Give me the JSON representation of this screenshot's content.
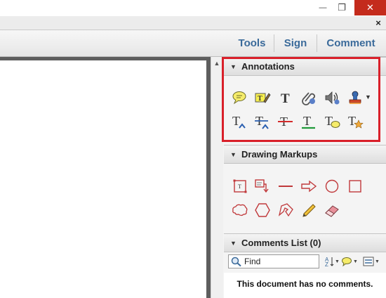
{
  "window": {
    "minimize_glyph": "—",
    "maximize_glyph": "❐",
    "close_glyph": "✕",
    "panel_close_glyph": "×"
  },
  "toolbar": {
    "tools_label": "Tools",
    "sign_label": "Sign",
    "comment_label": "Comment"
  },
  "pane": {
    "annotations": {
      "title": "Annotations",
      "tools": [
        "sticky-note",
        "highlight-text",
        "add-text",
        "attach-file",
        "record-audio",
        "stamp",
        "insert-text",
        "replace-text",
        "strikethrough",
        "underline",
        "add-note-to-text",
        "text-correction-markup"
      ]
    },
    "drawing_markups": {
      "title": "Drawing Markups",
      "tools": [
        "text-box",
        "callout",
        "line",
        "arrow",
        "oval",
        "rectangle",
        "cloud",
        "polygon",
        "connected-lines",
        "pencil",
        "pencil-eraser"
      ]
    },
    "comments_list": {
      "title": "Comments List (0)",
      "find_placeholder": "Find",
      "empty_message": "This document has no comments."
    }
  },
  "colors": {
    "accent_blue": "#3a6a9a",
    "highlight_red": "#d9202a",
    "markup_red": "#c0393b",
    "close_red": "#c42b1c"
  }
}
